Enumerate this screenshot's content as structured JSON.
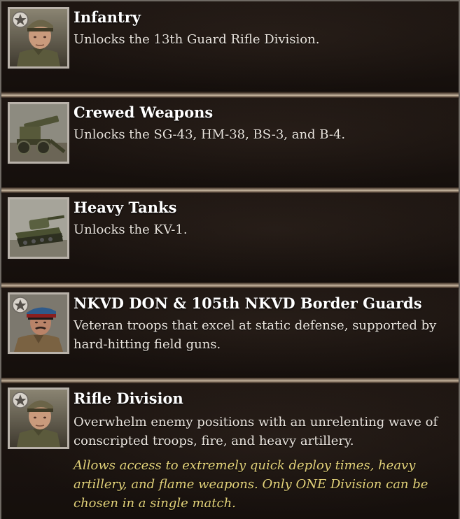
{
  "entries": [
    {
      "title": "Infantry",
      "description": "Unlocks the 13th Guard Rifle Division.",
      "icon": "soldier-portrait-icon"
    },
    {
      "title": "Crewed Weapons",
      "description": "Unlocks the SG-43, HM-38, BS-3, and B-4.",
      "icon": "artillery-gun-icon"
    },
    {
      "title": "Heavy Tanks",
      "description": "Unlocks the KV-1.",
      "icon": "heavy-tank-icon"
    },
    {
      "title": "NKVD DON & 105th NKVD Border Guards",
      "description": "Veteran troops that excel at static defense, supported by hard-hitting field guns.",
      "icon": "nkvd-officer-portrait-icon"
    },
    {
      "title": "Rifle Division",
      "description": "Overwhelm enemy positions with an unrelenting wave of conscripted troops, fire, and heavy artillery.",
      "note": "Allows access to extremely quick deploy times, heavy artillery, and flame weapons. Only ONE Division can be chosen in a single match.",
      "icon": "soldier-portrait-icon"
    }
  ],
  "colors": {
    "title": "#ffffff",
    "description": "#ebe5de",
    "note": "#e3d27a",
    "frame": "#b9b2aa"
  }
}
